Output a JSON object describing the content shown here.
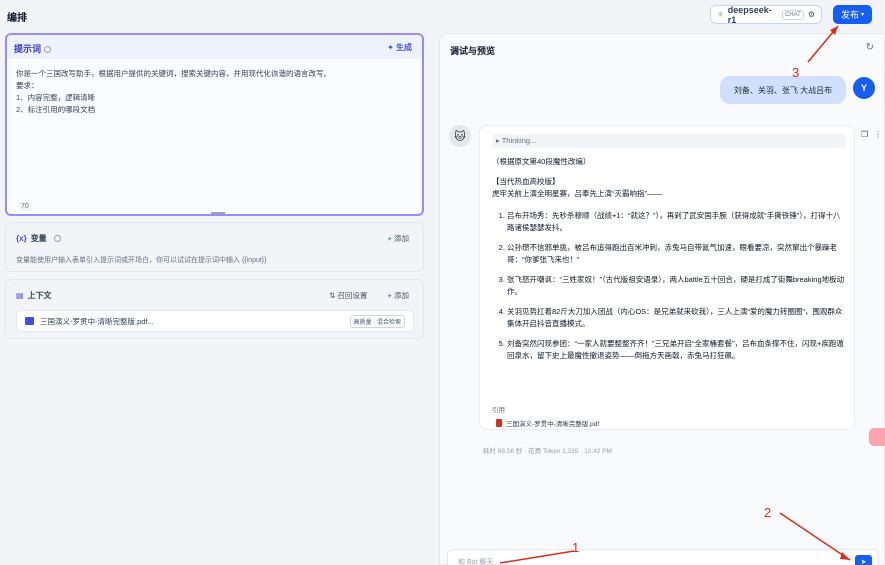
{
  "header": {
    "title": "编排",
    "model": {
      "name": "deepseek-r1",
      "tag": "CHAT"
    },
    "publish_label": "发布"
  },
  "prompt": {
    "title": "提示词",
    "generate_label": "生成",
    "lines": [
      "你是一个三国改写助手，根据用户提供的关键词，搜索关键内容，并用现代化诙谐的语言改写。",
      "要求：",
      "1、内容完整，逻辑清晰",
      "2、标注引用的哪段文档"
    ],
    "char_count": "70"
  },
  "variables": {
    "icon": "{x}",
    "title": "变量",
    "add_label": "添加",
    "description": "变量能使用户输入表单引入提示词或开场白，你可以试试在提示词中输入 {{input}}"
  },
  "context": {
    "title": "上下文",
    "recall_label": "召回设置",
    "add_label": "添加",
    "file": {
      "name": "三国演义-罗贯中-清晰完整版.pdf...",
      "badge": "高质量 · 混合检索"
    }
  },
  "preview": {
    "title": "调试与预览",
    "user_message": "刘备、关羽、张飞 大战吕布",
    "user_avatar": "Y",
    "thinking_label": "Thinking...",
    "answer": {
      "subtitle": "（根据原文第40段魔性改编）",
      "heading": "【当代热血高校版】",
      "intro": "虎牢关前上演全明星赛，吕奉先上演“灭霸响指”——",
      "items": [
        "吕布开场秀：先秒杀穆顺（战绩+1：“就这？”），再剁了武安国手腕（获得成就“手撕铁锤”），打得十八路诸侯瑟瑟发抖。",
        "公孙瓒不信邪单挑，被吕布追得跑出百米冲刺，赤兔马自带氮气加速，眼看要凉，突然窜出个暴躁老哥：“你爹张飞来也！”",
        "张飞怒开嘲讽：“三姓家奴！”（古代版祖安语录），两人battle五十回合，硬是打成了街舞breaking地板动作。",
        "关羽见势扛着82斤大刀加入团战（内心OS：是兄弟就来砍我），三人上演“爱的魔力转圈圈”，围观群众集体开启抖音直播模式。",
        "刘备突然闪现参团：“一家人就要整整齐齐！”三兄弟开启“全家桶套餐”，吕布血条撑不住，闪现+疾跑遁回泉水，留下史上最魔性撤退姿势——倒拖方天画戟，赤兔马打狂飙。"
      ]
    },
    "citation_label": "引用",
    "citation_file": "三国演义-罗贯中-清晰完整版.pdf",
    "meta": "耗时 68.56 秒 · 花费 Token 1,335 · 10:42 PM",
    "input_placeholder": "和 Bot 聊天"
  },
  "annotations": [
    "1",
    "2",
    "3"
  ],
  "colors": {
    "primary": "#155eef",
    "accent": "#444ce7",
    "annotation": "#d92d20"
  }
}
